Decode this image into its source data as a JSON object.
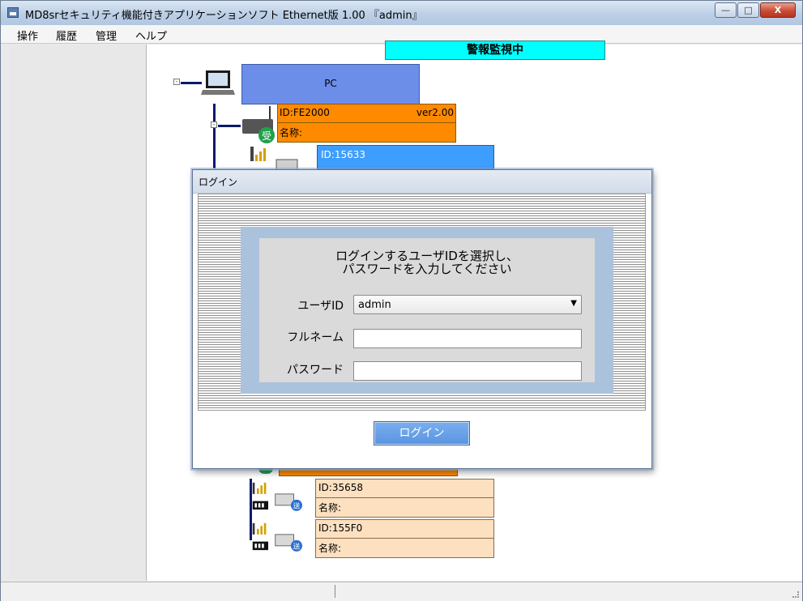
{
  "window": {
    "title": "MD8srセキュリティ機能付きアプリケーションソフト Ethernet版 1.00 『admin』",
    "minimize": "—",
    "maximize": "□",
    "close": "X"
  },
  "menu": {
    "items": [
      "操作",
      "履歴",
      "管理",
      "ヘルプ"
    ]
  },
  "status_banner": "警報監視中",
  "tree": {
    "pc_label": "PC",
    "receiver": {
      "id": "ID:FE2000",
      "version": "ver2.00",
      "name": "名称:",
      "badge": "受"
    },
    "selected_node": {
      "id": "ID:15633"
    },
    "nodes": [
      {
        "id": "ID:35658",
        "name": "名称:",
        "badge": "送"
      },
      {
        "id": "ID:155F0",
        "name": "名称:",
        "badge": "送"
      }
    ]
  },
  "dialog": {
    "title": "ログイン",
    "message_line1": "ログインするユーザIDを選択し、",
    "message_line2": "パスワードを入力してください",
    "userid_label": "ユーザID",
    "userid_value": "admin",
    "fullname_label": "フルネーム",
    "fullname_value": "",
    "password_label": "パスワード",
    "password_value": "",
    "login_button": "ログイン"
  }
}
